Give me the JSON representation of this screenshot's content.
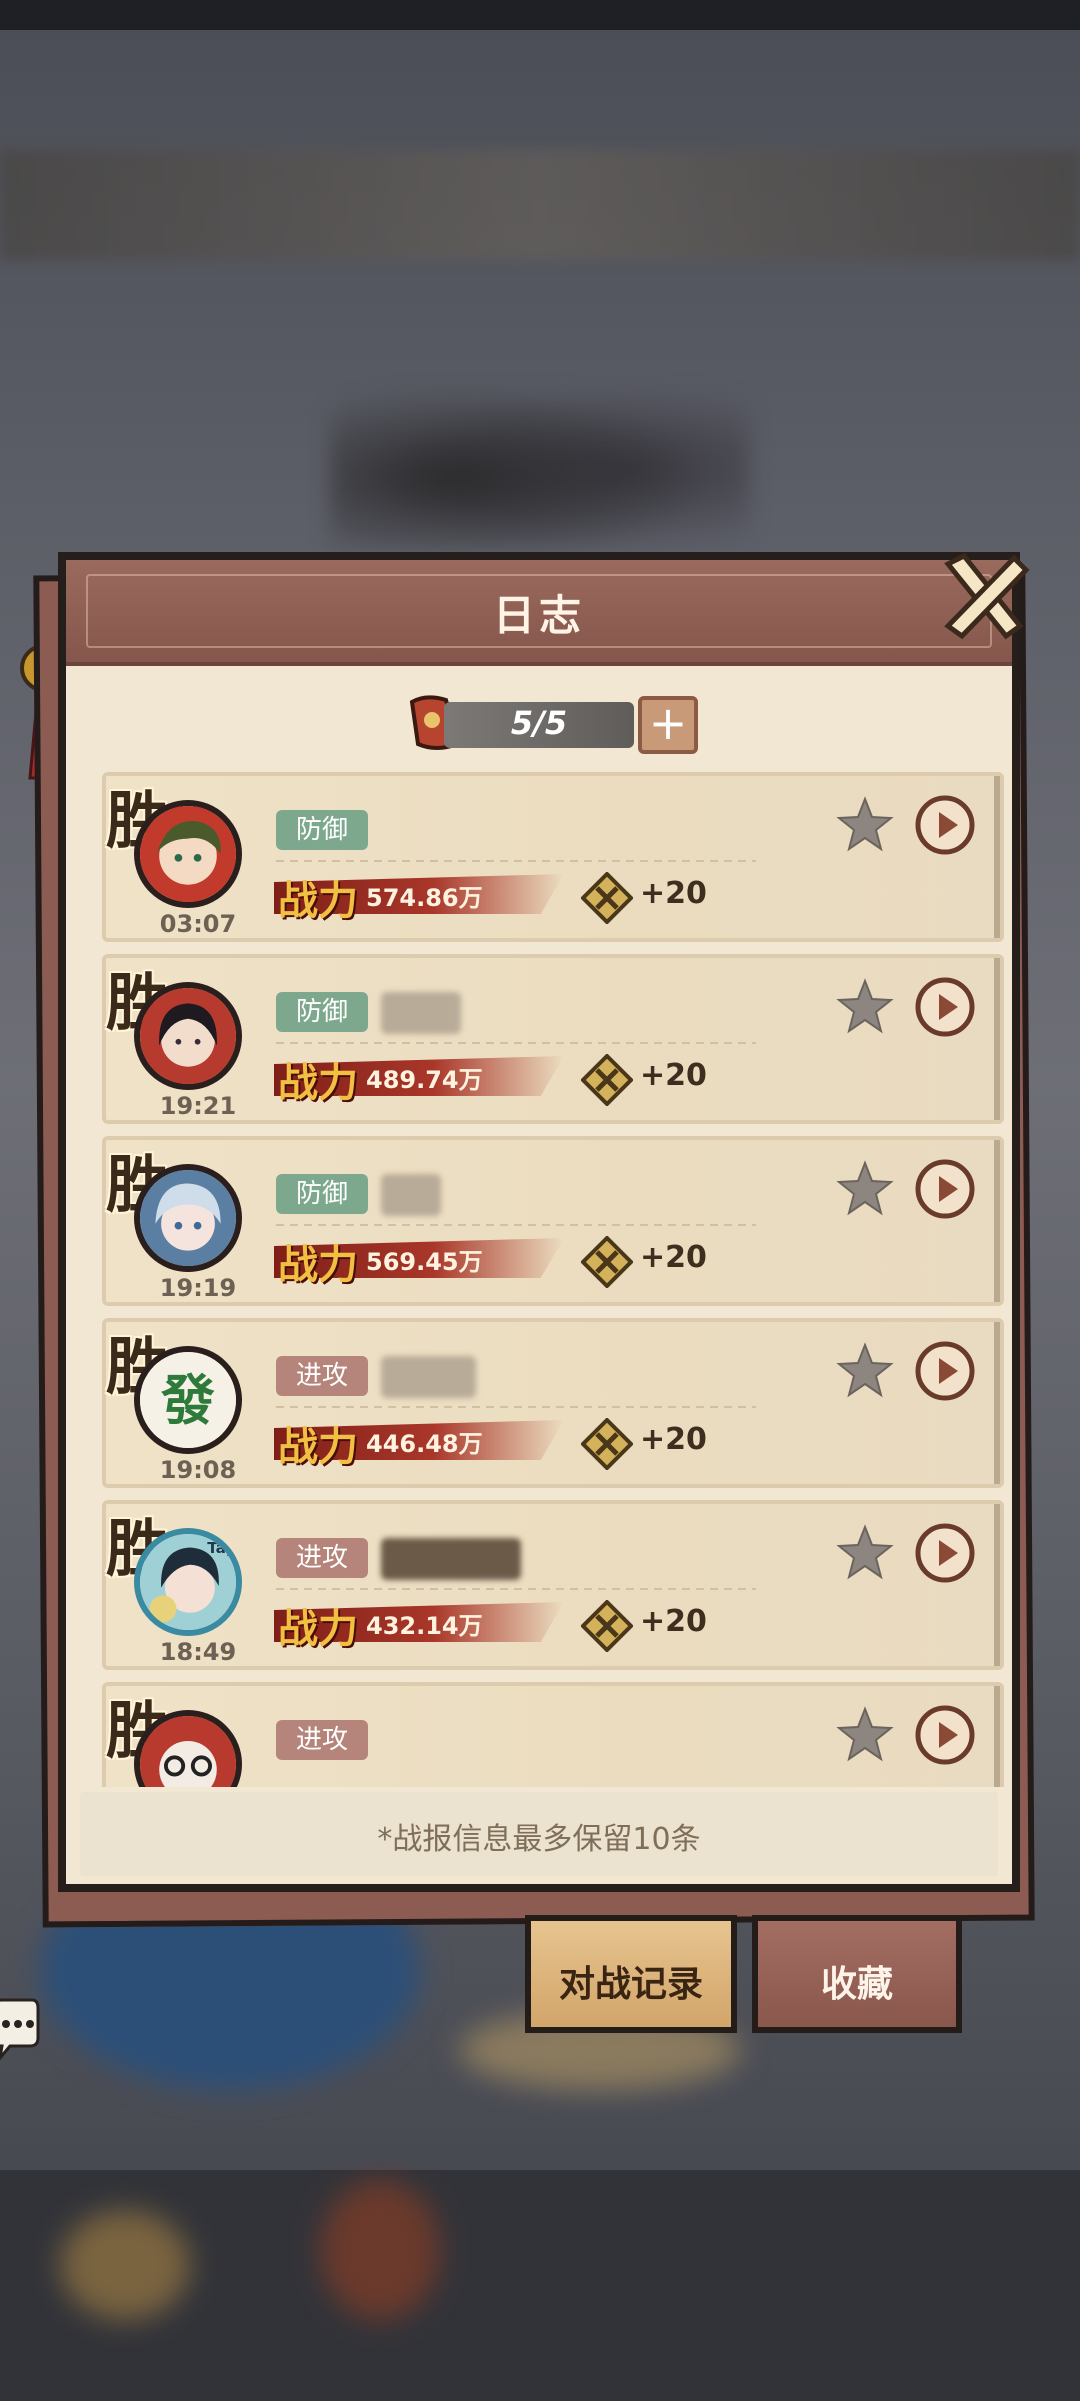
{
  "dialog": {
    "title": "日志",
    "counter": "5/5",
    "counter_plus": "+",
    "footer_note": "*战报信息最多保留10条"
  },
  "colors": {
    "defense_tag": "#7ea88e",
    "attack_tag": "#b5857b",
    "header": "#8f5f54",
    "panel": "#f2e7d3"
  },
  "records": [
    {
      "result": "胜",
      "time": "03:07",
      "mode": "防御",
      "power_label": "战力",
      "power": "574.86万",
      "reward": "+20",
      "avatar": "character-portrait-green-hair"
    },
    {
      "result": "胜",
      "time": "19:21",
      "mode": "防御",
      "power_label": "战力",
      "power": "489.74万",
      "reward": "+20",
      "avatar": "character-portrait-dark-hair"
    },
    {
      "result": "胜",
      "time": "19:19",
      "mode": "防御",
      "power_label": "战力",
      "power": "569.45万",
      "reward": "+20",
      "avatar": "character-portrait-white-hair"
    },
    {
      "result": "胜",
      "time": "19:08",
      "mode": "进攻",
      "power_label": "战力",
      "power": "446.48万",
      "reward": "+20",
      "avatar": "mahjong-fa-tile-avatar"
    },
    {
      "result": "胜",
      "time": "18:49",
      "mode": "进攻",
      "power_label": "战力",
      "power": "432.14万",
      "reward": "+20",
      "avatar": "character-portrait-tap-badge"
    },
    {
      "result": "胜",
      "time": "",
      "mode": "进攻",
      "power_label": "",
      "power": "",
      "reward": "",
      "avatar": "character-portrait-partial"
    }
  ],
  "tabs": {
    "records": "对战记录",
    "favorites": "收藏"
  }
}
